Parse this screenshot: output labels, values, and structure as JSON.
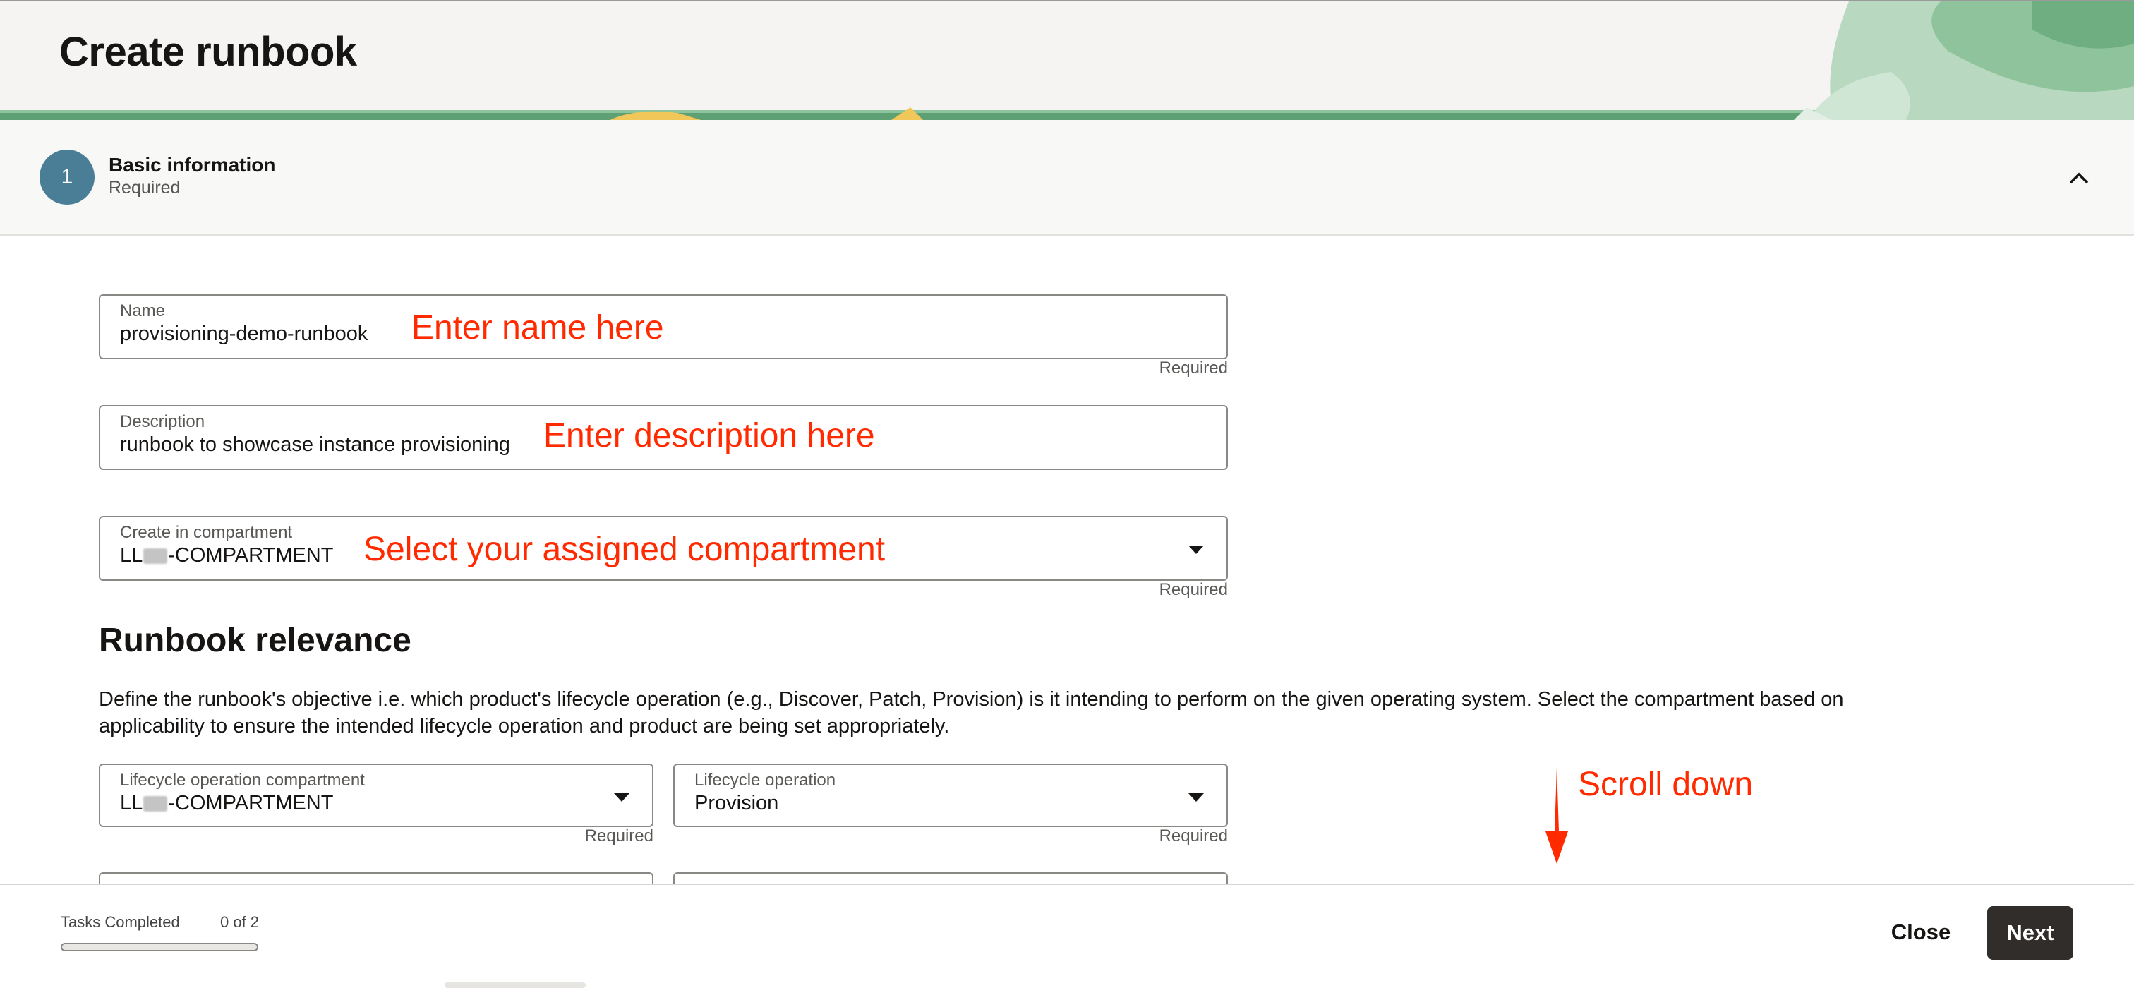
{
  "header": {
    "title": "Create runbook"
  },
  "step": {
    "number": "1",
    "title": "Basic information",
    "subtitle": "Required"
  },
  "form": {
    "name": {
      "label": "Name",
      "value": "provisioning-demo-runbook",
      "helper": "Required"
    },
    "description": {
      "label": "Description",
      "value": "runbook to showcase instance provisioning"
    },
    "compartment": {
      "label": "Create in compartment",
      "value_prefix": "LL",
      "value_suffix": "-COMPARTMENT",
      "helper": "Required"
    }
  },
  "relevance": {
    "title": "Runbook relevance",
    "description": "Define the runbook's objective i.e. which product's lifecycle operation (e.g., Discover, Patch, Provision) is it intending to perform on the given operating system. Select the compartment based on applicability to ensure the intended lifecycle operation and product are being set appropriately.",
    "lifecycle_compartment": {
      "label": "Lifecycle operation compartment",
      "value_prefix": "LL",
      "value_suffix": "-COMPARTMENT",
      "helper": "Required"
    },
    "lifecycle_operation": {
      "label": "Lifecycle operation",
      "value": "Provision",
      "helper": "Required"
    }
  },
  "annotations": {
    "name": "Enter name here",
    "description": "Enter description here",
    "compartment": "Select your assigned compartment",
    "scroll": "Scroll down",
    "color": "#ff2a00"
  },
  "footer": {
    "tasks_label": "Tasks Completed",
    "tasks_count": "0 of 2",
    "progress_fraction": 0,
    "close_label": "Close",
    "next_label": "Next"
  },
  "colors": {
    "step_circle": "#4a7d96",
    "next_button": "#312d2a",
    "annotation": "#ff2a00"
  },
  "icons": {
    "collapse": "chevron-up-icon",
    "dropdown": "caret-down-icon",
    "arrow": "arrow-down-icon"
  }
}
